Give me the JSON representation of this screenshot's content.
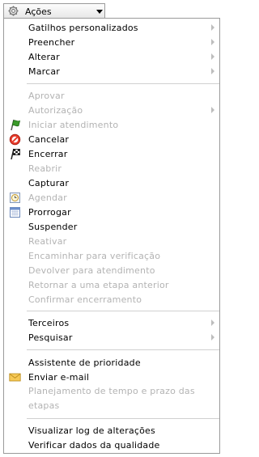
{
  "toolbar": {
    "actions_label": "Ações"
  },
  "groups": {
    "g1": [
      "Gatilhos personalizados",
      "Preencher",
      "Alterar",
      "Marcar"
    ],
    "g2": [
      "Aprovar",
      "Autorização",
      "Iniciar atendimento",
      "Cancelar",
      "Encerrar",
      "Reabrir",
      "Capturar",
      "Agendar",
      "Prorrogar",
      "Suspender",
      "Reativar",
      "Encaminhar para verificação",
      "Devolver para atendimento",
      "Retornar a uma etapa anterior",
      "Confirmar encerramento"
    ],
    "g3": [
      "Terceiros",
      "Pesquisar"
    ],
    "g4": [
      "Assistente de prioridade",
      "Enviar e-mail",
      "Planejamento de tempo e prazo das etapas"
    ],
    "g5": [
      "Visualizar log de alterações",
      "Verificar dados da qualidade"
    ]
  },
  "icons": {
    "iniciar": "green-flag-icon",
    "cancelar": "cancel-icon",
    "encerrar": "checkered-flag-icon",
    "agendar": "clock-calendar-icon",
    "prorrogar": "calendar-icon",
    "email": "envelope-icon"
  },
  "colors": {
    "disabled_text": "#b3b3b3",
    "separator": "#d0d0d0"
  }
}
